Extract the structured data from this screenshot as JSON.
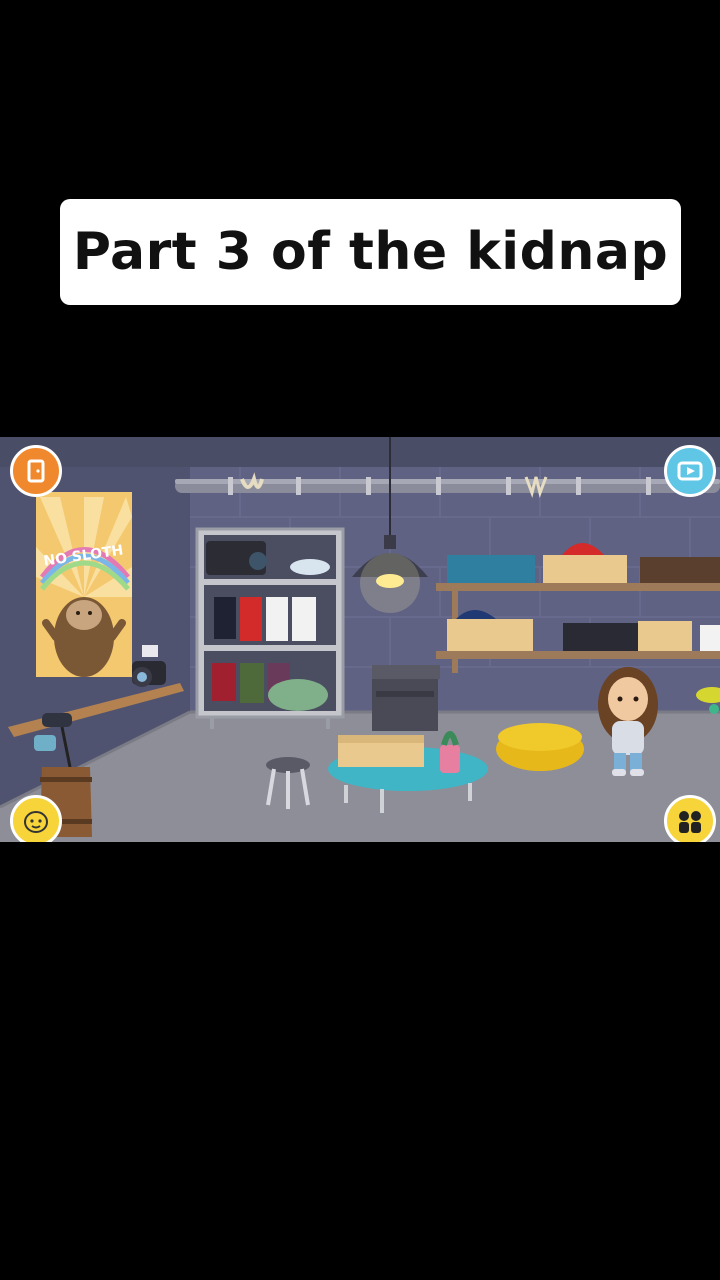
{
  "caption": {
    "text": "Part 3 of the kidnap"
  },
  "scene": {
    "poster_text": "NO SLOTH",
    "buttons": {
      "top_left": "exit-door-icon",
      "top_right": "video-record-icon",
      "bottom_left": "character-face-icon",
      "bottom_right": "characters-icon"
    }
  },
  "colors": {
    "background": "#000000",
    "wall": "#5b5f7e",
    "floor": "#8e8e98",
    "button_orange": "#f0892e",
    "button_cyan": "#5fc6e6",
    "button_yellow": "#f6d43a"
  }
}
